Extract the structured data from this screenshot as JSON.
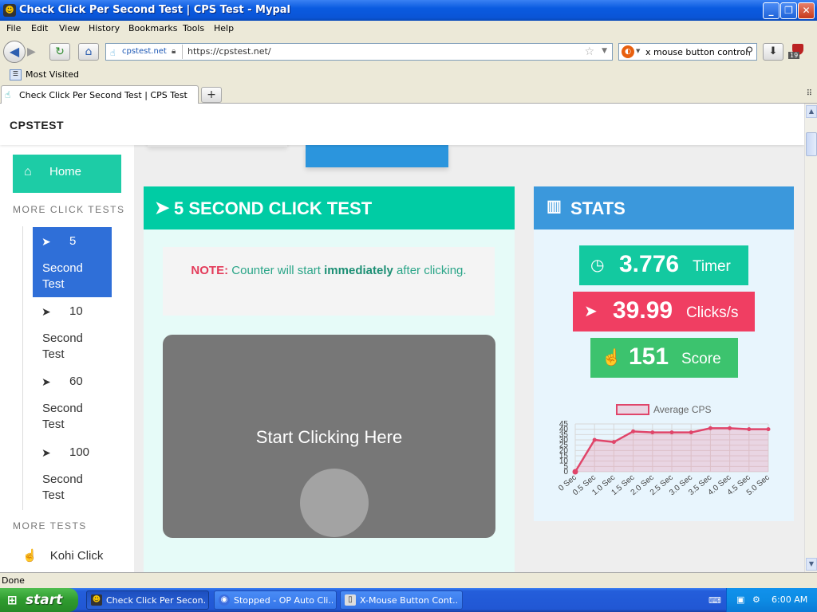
{
  "window": {
    "title": "Check Click Per Second Test | CPS Test - Mypal",
    "min": "_",
    "max": "❐",
    "close": "✕"
  },
  "menu": [
    "File",
    "Edit",
    "View",
    "History",
    "Bookmarks",
    "Tools",
    "Help"
  ],
  "nav": {
    "site_identity": "cpstest.net",
    "url": "https://cpstest.net/",
    "search_value": "x mouse button control"
  },
  "bookmarks": {
    "most_visited": "Most Visited"
  },
  "tabs": [
    {
      "label": "Check Click Per Second Test | CPS Test"
    }
  ],
  "page": {
    "brand": "CPSTEST",
    "sidebar": {
      "home": "Home",
      "more_click_tests": "MORE CLICK TESTS",
      "items": [
        {
          "num": "5",
          "rest": "Second Test"
        },
        {
          "num": "10",
          "rest": "Second Test"
        },
        {
          "num": "60",
          "rest": "Second Test"
        },
        {
          "num": "100",
          "rest": "Second Test"
        }
      ],
      "more_tests": "MORE TESTS",
      "kohi": "Kohi Click"
    },
    "test_panel": {
      "title": "5 SECOND CLICK TEST",
      "note_label": "NOTE:",
      "note_pre": "Counter will start",
      "note_bold": "immediately",
      "note_post": "after clicking.",
      "click_text": "Start Clicking Here"
    },
    "stats": {
      "title": "STATS",
      "timer_value": "3.776",
      "timer_unit": "Timer",
      "cps_value": "39.99",
      "cps_unit": "Clicks/s",
      "score_value": "151",
      "score_unit": "Score"
    }
  },
  "chart_data": {
    "type": "line",
    "legend": "Average CPS",
    "categories": [
      "0 Sec",
      "0.5 Sec",
      "1.0 Sec",
      "1.5 Sec",
      "2.0 Sec",
      "2.5 Sec",
      "3.0 Sec",
      "3.5 Sec",
      "4.0 Sec",
      "4.5 Sec",
      "5.0 Sec"
    ],
    "values": [
      0,
      30,
      28,
      38,
      37,
      37,
      37,
      41,
      41,
      40,
      40
    ],
    "yticks": [
      0,
      5,
      10,
      15,
      20,
      25,
      30,
      35,
      40,
      45
    ],
    "ylim": [
      0,
      45
    ],
    "color": "#e0456a",
    "fill": "rgba(236,120,150,0.25)"
  },
  "status": "Done",
  "taskbar": {
    "start": "start",
    "tasks": [
      "Check Click Per Secon...",
      "Stopped - OP Auto Cli...",
      "X-Mouse Button Cont..."
    ],
    "time": "6:00 AM"
  },
  "colors": {
    "teal": "#00cca4",
    "blue": "#3b98dc",
    "pink": "#f03e62",
    "green": "#3cc36e",
    "active_item": "#2f6fd8"
  }
}
